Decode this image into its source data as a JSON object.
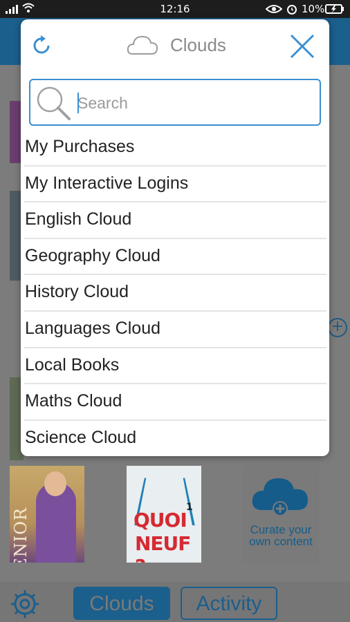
{
  "status_bar": {
    "time": "12:16",
    "battery_percent": "10%",
    "icons": [
      "signal-icon",
      "wifi-icon",
      "eye-icon",
      "alarm-icon",
      "battery-charging-icon"
    ]
  },
  "modal": {
    "title": "Clouds",
    "search": {
      "placeholder": "Search",
      "value": ""
    },
    "items": [
      {
        "label": "My Purchases"
      },
      {
        "label": "My Interactive Logins"
      },
      {
        "label": "English Cloud"
      },
      {
        "label": "Geography Cloud"
      },
      {
        "label": "History Cloud"
      },
      {
        "label": "Languages Cloud"
      },
      {
        "label": "Local Books"
      },
      {
        "label": "Maths Cloud"
      },
      {
        "label": "Science Cloud"
      }
    ]
  },
  "background": {
    "books": [
      {
        "title": "SENIOR"
      },
      {
        "title_line1": "QUOI",
        "title_line2": "NEUF ?",
        "number": "1"
      },
      {
        "label": "Curate your own content"
      }
    ]
  },
  "bottom_bar": {
    "clouds_label": "Clouds",
    "activity_label": "Activity"
  },
  "colors": {
    "accent": "#1b5f8c",
    "search_border": "#3a8fd1",
    "close_icon": "#3a8fd1"
  }
}
